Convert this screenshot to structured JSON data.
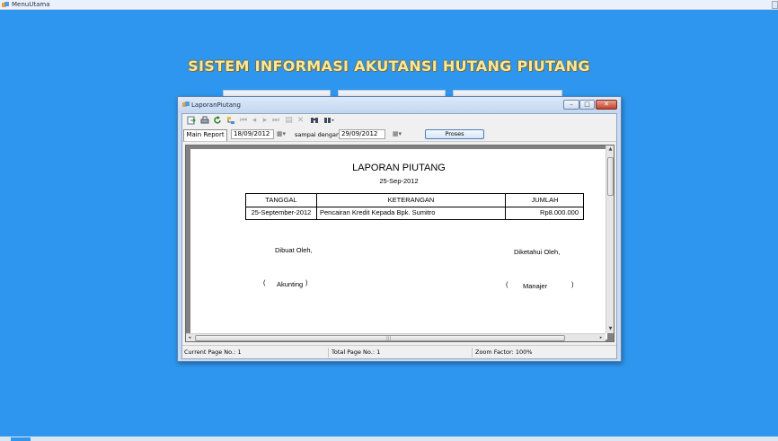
{
  "main_window": {
    "title": "MenuUtama"
  },
  "app_heading": "SISTEM INFORMASI AKUTANSI HUTANG PIUTANG",
  "child_window": {
    "title": "LaporanPiutang",
    "controls": {
      "minimize": "–",
      "maximize": "□",
      "close": "✕"
    }
  },
  "toolbar": {
    "icons": [
      "export-icon",
      "print-icon",
      "refresh-icon",
      "group-tree-icon",
      "first-page-icon",
      "previous-page-icon",
      "next-page-icon",
      "last-page-icon",
      "goto-page-icon",
      "stop-icon",
      "search-icon",
      "zoom-icon"
    ]
  },
  "filter": {
    "tab_label": "Main Report",
    "start_date": "18/09/2012",
    "separator_label": "sampai dengan",
    "end_date": "29/09/2012",
    "submit_label": "Proses"
  },
  "report": {
    "title": "LAPORAN PIUTANG",
    "date": "25-Sep-2012",
    "columns": [
      "TANGGAL",
      "KETERANGAN",
      "JUMLAH"
    ],
    "rows": [
      {
        "tanggal": "25-September-2012",
        "keterangan": "Pencairan Kredit Kepada Bpk. Sumitro",
        "jumlah": "Rp8.000.000"
      }
    ],
    "made_by_label": "Dibuat Oleh,",
    "known_by_label": "Diketahui Oleh,",
    "made_by_role": "Akunting",
    "known_by_role": "Manajer",
    "open_paren": "(",
    "close_paren": ")"
  },
  "statusbar": {
    "current_page": "Current Page No.: 1",
    "total_page": "Total Page No.: 1",
    "zoom": "Zoom Factor: 100%"
  },
  "colors": {
    "desktop_bg": "#2e96ee",
    "heading_text": "#f3e9a4",
    "close_button": "#c4432c"
  }
}
